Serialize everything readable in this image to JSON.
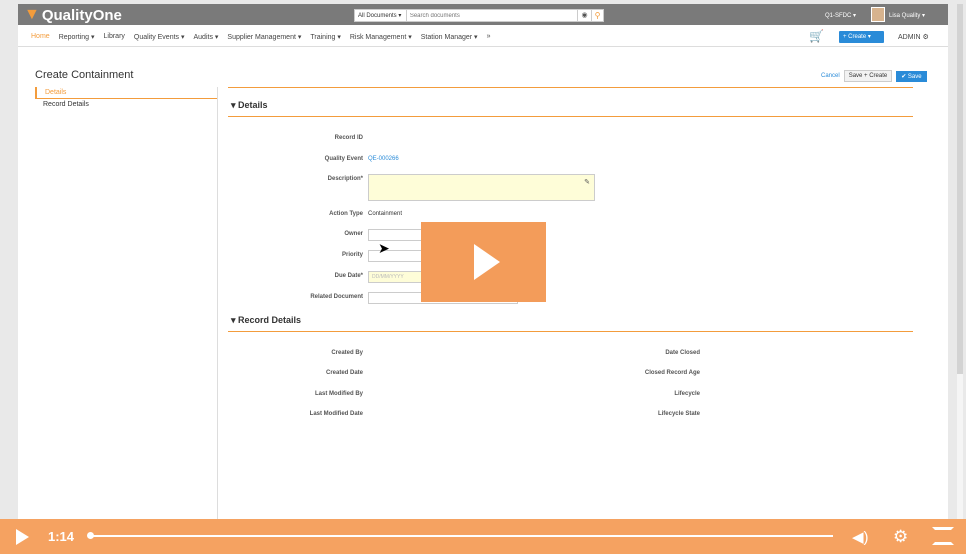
{
  "app": {
    "name": "QualityOne"
  },
  "search": {
    "scope": "All Documents ▾",
    "placeholder": "Search documents"
  },
  "header": {
    "vault": "Q1-SFDC ▾",
    "user": "Lisa Quality ▾"
  },
  "nav": {
    "items": [
      "Home",
      "Reporting ▾",
      "Library",
      "Quality Events ▾",
      "Audits ▾",
      "Supplier Management ▾",
      "Training ▾",
      "Risk Management ▾",
      "Station Manager ▾",
      "»"
    ],
    "cart_count": "0",
    "create_label": "+ Create ▾",
    "admin_label": "ADMIN ⚙"
  },
  "page": {
    "title": "Create Containment",
    "cancel": "Cancel",
    "save_create": "Save + Create",
    "save": "✔ Save"
  },
  "sidebar": {
    "items": [
      "Details",
      "Record Details"
    ]
  },
  "details": {
    "heading": "▾ Details",
    "labels": {
      "record_id": "Record ID",
      "quality_event": "Quality Event",
      "description": "Description*",
      "action_type": "Action Type",
      "owner": "Owner",
      "priority": "Priority",
      "due_date": "Due Date*",
      "related_document": "Related Document"
    },
    "values": {
      "quality_event": "QE-000266",
      "action_type": "Containment",
      "due_date_placeholder": "DD/MM/YYYY"
    }
  },
  "record_details": {
    "heading": "▾ Record Details",
    "left": [
      "Created By",
      "Created Date",
      "Last Modified By",
      "Last Modified Date"
    ],
    "right": [
      "Date Closed",
      "Closed Record Age",
      "Lifecycle",
      "Lifecycle State"
    ]
  },
  "video": {
    "time": "1:14",
    "progress": 0.0
  }
}
